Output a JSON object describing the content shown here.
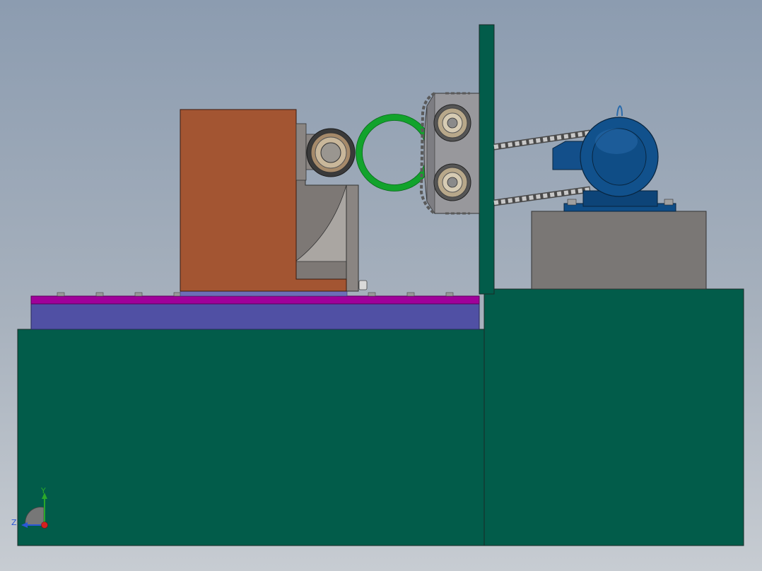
{
  "viewport": {
    "background_top": "#8c9cb0",
    "background_bottom": "#c7ccd2"
  },
  "model": {
    "colors": {
      "base_frame": "#025c4a",
      "clamp_plate": "#a0009a",
      "slide_plate": "#5050a4",
      "bearing_block": "#a35532",
      "support_bracket": "#7d7875",
      "ring_part": "#12a32c",
      "roller_housing": "#98989c",
      "roller_bearing": "#b8a88a",
      "chain": "#8a8a8a",
      "motor": "#0f4d86",
      "motor_pedestal": "#7a7775"
    }
  },
  "triad": {
    "y_label": "Y",
    "z_label": "Z",
    "y_color": "#2aa82a",
    "z_color": "#2b57d6",
    "x_color": "#d42020"
  }
}
